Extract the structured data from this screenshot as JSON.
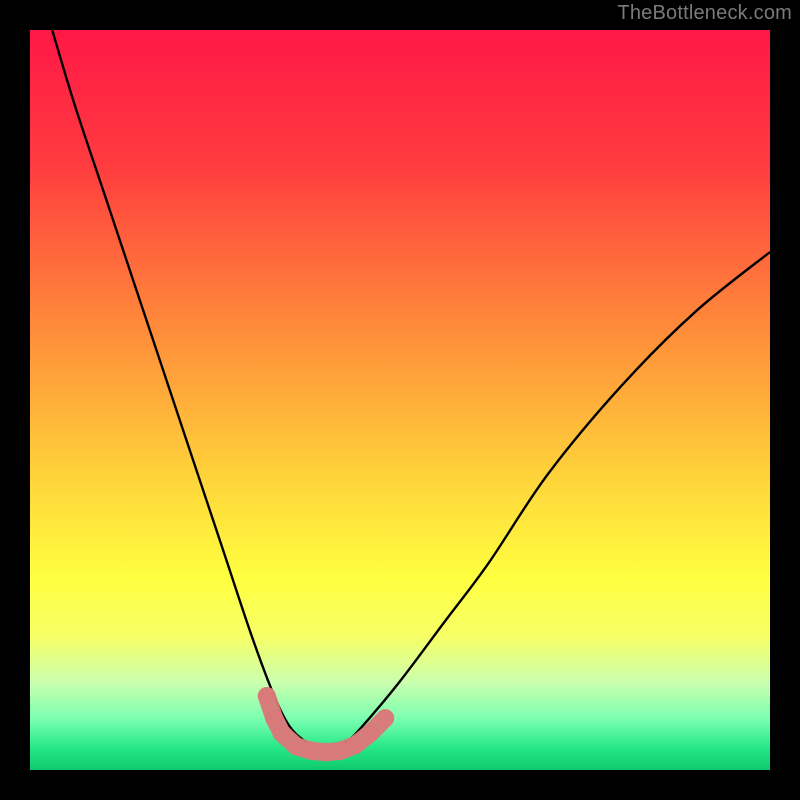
{
  "attribution": "TheBottleneck.com",
  "chart_data": {
    "type": "line",
    "title": "",
    "xlabel": "",
    "ylabel": "",
    "xlim": [
      0,
      100
    ],
    "ylim": [
      0,
      100
    ],
    "grid": false,
    "series": [
      {
        "name": "bottleneck-curve",
        "color": "#000000",
        "x": [
          3,
          6,
          10,
          14,
          18,
          22,
          26,
          30,
          33,
          35,
          37,
          39,
          41,
          43,
          45,
          50,
          56,
          62,
          70,
          80,
          90,
          100
        ],
        "y": [
          100,
          90,
          78,
          66,
          54,
          42,
          30,
          18,
          10,
          6,
          4,
          3,
          3,
          4,
          6,
          12,
          20,
          28,
          40,
          52,
          62,
          70
        ]
      }
    ],
    "markers": {
      "name": "highlight-points",
      "color": "#d97a7a",
      "points": [
        {
          "x": 32,
          "y": 10
        },
        {
          "x": 33,
          "y": 7
        },
        {
          "x": 34,
          "y": 5
        },
        {
          "x": 36,
          "y": 3.2
        },
        {
          "x": 38,
          "y": 2.6
        },
        {
          "x": 40,
          "y": 2.4
        },
        {
          "x": 42,
          "y": 2.6
        },
        {
          "x": 44,
          "y": 3.4
        },
        {
          "x": 46,
          "y": 5
        },
        {
          "x": 48,
          "y": 7
        }
      ]
    },
    "background_gradient": {
      "stops": [
        {
          "offset": 0.0,
          "color": "#ff1846"
        },
        {
          "offset": 0.18,
          "color": "#ff3b3f"
        },
        {
          "offset": 0.4,
          "color": "#ff8a3a"
        },
        {
          "offset": 0.6,
          "color": "#ffd23a"
        },
        {
          "offset": 0.74,
          "color": "#ffff40"
        },
        {
          "offset": 0.82,
          "color": "#f6ff66"
        },
        {
          "offset": 0.88,
          "color": "#ccffad"
        },
        {
          "offset": 0.93,
          "color": "#7dffb0"
        },
        {
          "offset": 0.97,
          "color": "#25e889"
        },
        {
          "offset": 1.0,
          "color": "#10c96f"
        }
      ]
    }
  }
}
